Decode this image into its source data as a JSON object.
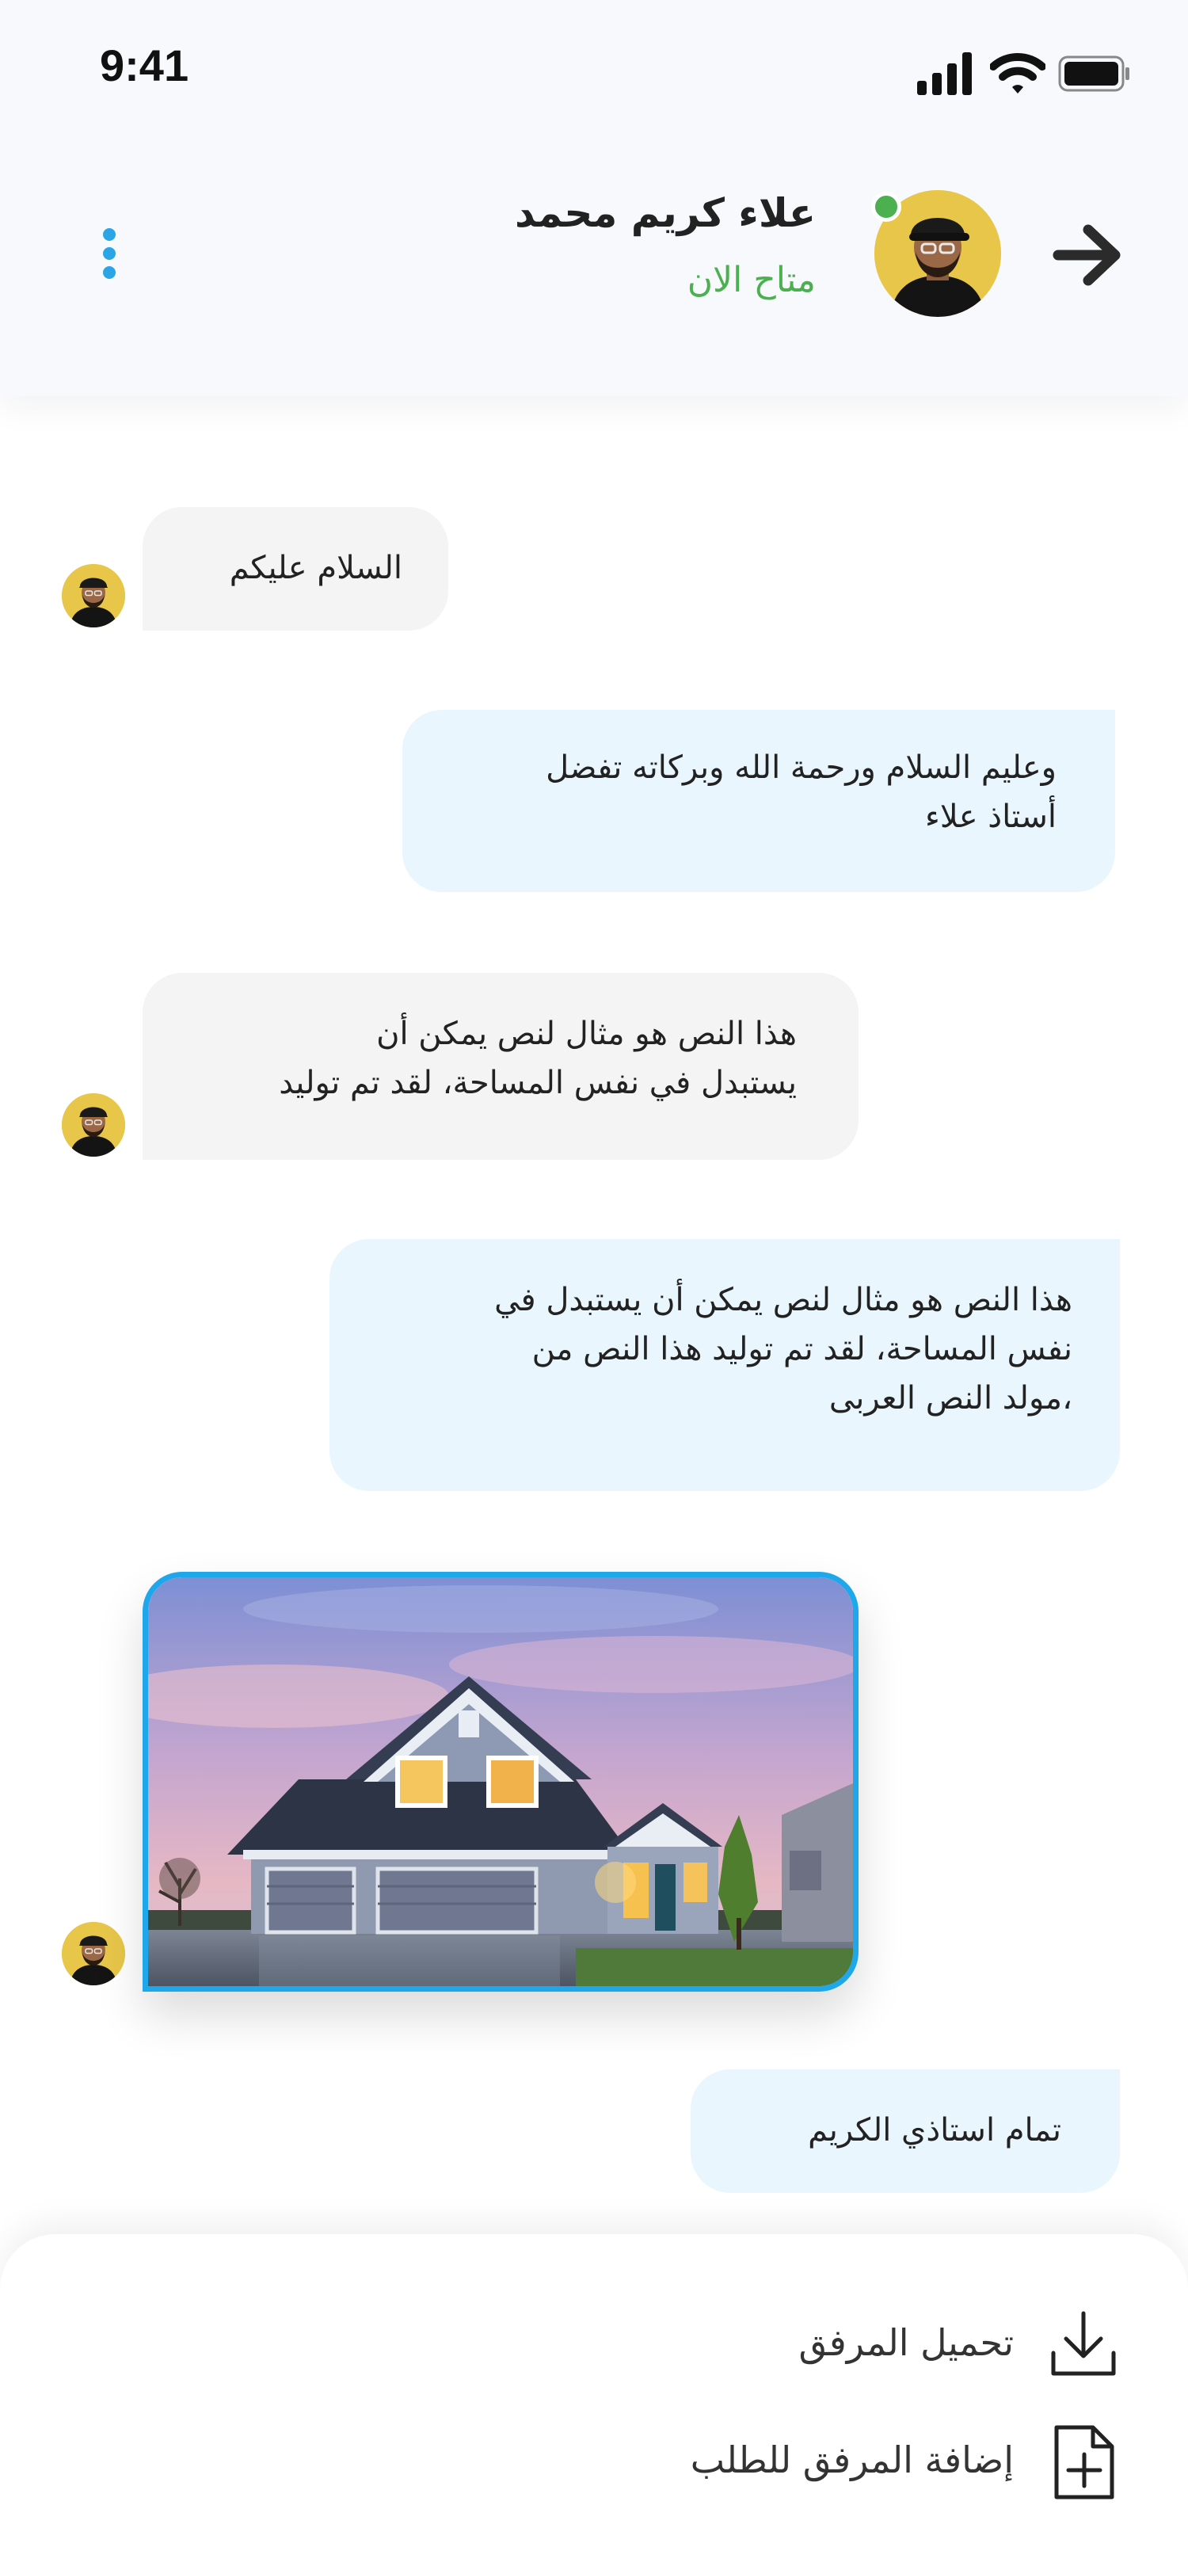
{
  "status_bar": {
    "time": "9:41",
    "icons": [
      "signal-icon",
      "wifi-icon",
      "battery-icon"
    ]
  },
  "header": {
    "contact_name": "علاء كريم محمد",
    "contact_status": "متاح الان",
    "back_icon": "arrow-right-icon",
    "menu_icon": "more-vertical-icon",
    "online": true
  },
  "messages": [
    {
      "direction": "incoming",
      "text": "السلام عليكم"
    },
    {
      "direction": "outgoing",
      "text": "وعليم السلام ورحمة الله وبركاته تفضل\nأستاذ علاء"
    },
    {
      "direction": "incoming",
      "text": "هذا النص هو مثال لنص يمكن أن\nيستبدل في نفس المساحة، لقد تم توليد"
    },
    {
      "direction": "outgoing",
      "text": "هذا النص هو مثال لنص يمكن أن يستبدل في\nنفس المساحة، لقد تم توليد هذا النص من\n،مولد النص العربى"
    },
    {
      "direction": "incoming",
      "type": "image",
      "image_subject": "house-at-dusk"
    },
    {
      "direction": "outgoing",
      "text": "تمام استاذي الكريم"
    }
  ],
  "attachment_sheet": {
    "items": [
      {
        "label": "تحميل المرفق",
        "icon": "download-icon"
      },
      {
        "label": "إضافة المرفق للطلب",
        "icon": "file-add-icon"
      }
    ]
  },
  "colors": {
    "accent": "#1ea7ea",
    "online": "#4caf50",
    "incoming_bubble": "#f4f4f4",
    "outgoing_bubble": "#e9f6fd",
    "avatar_bg": "#e8c64a"
  }
}
